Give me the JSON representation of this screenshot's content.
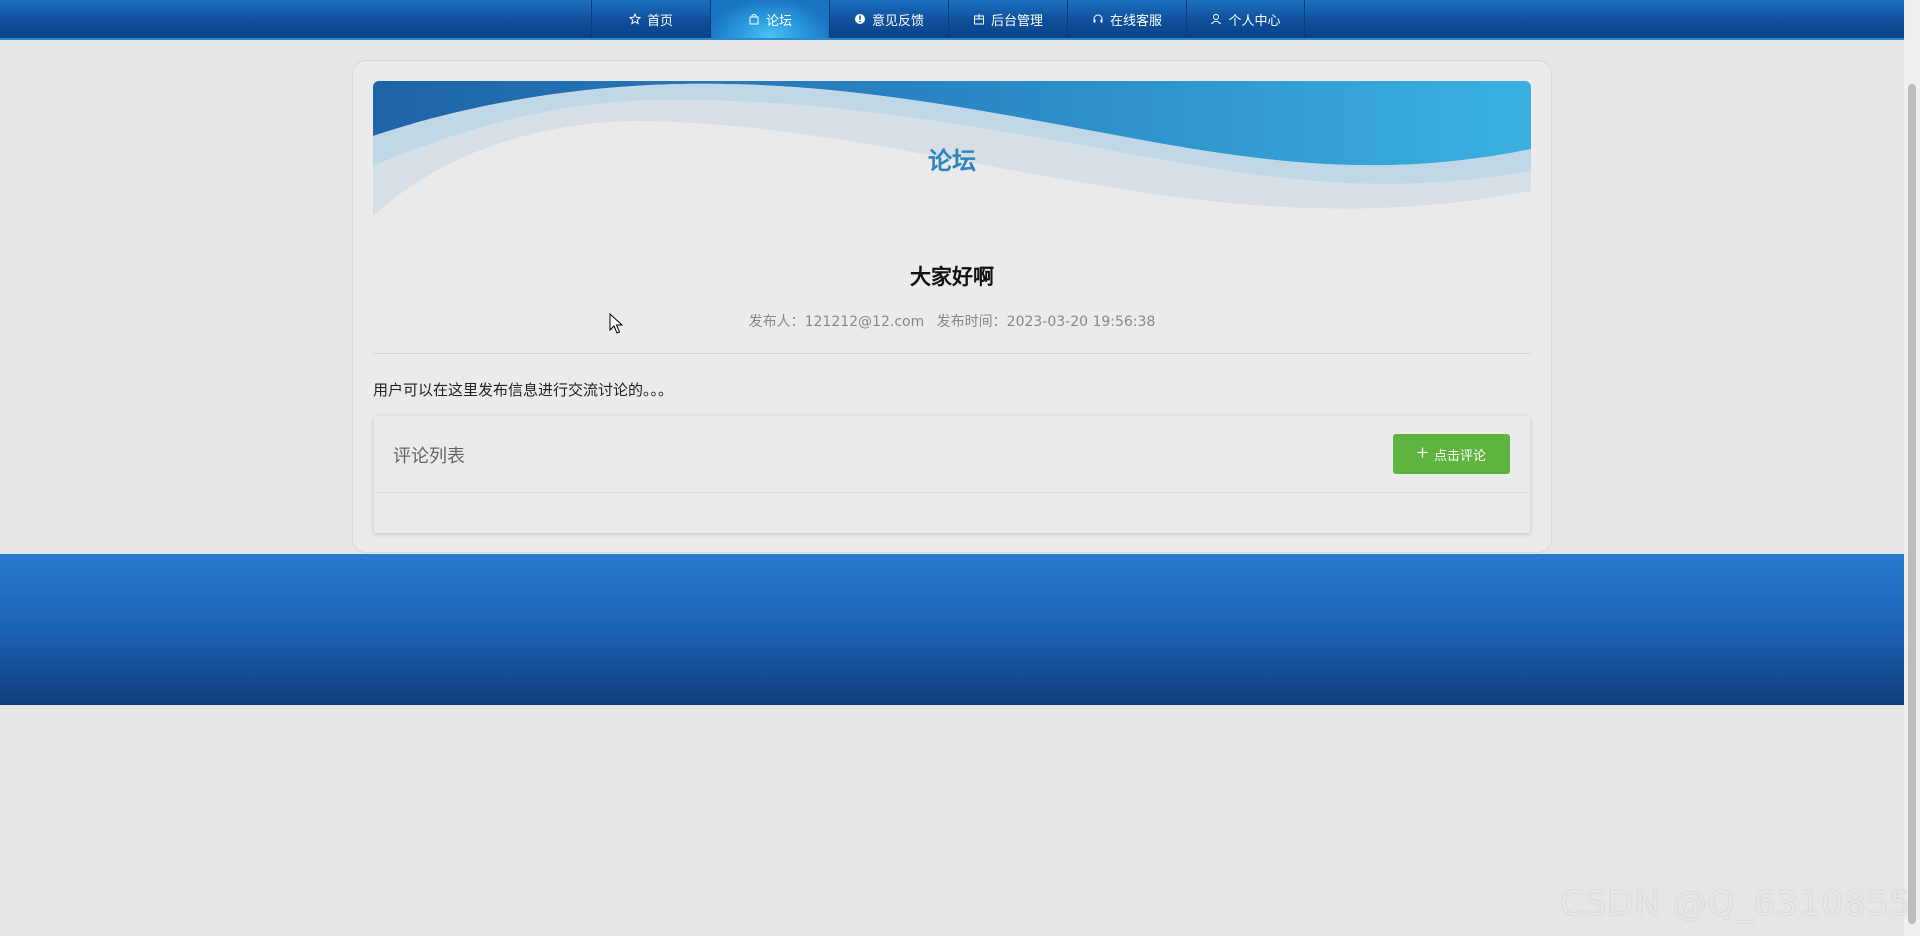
{
  "nav": {
    "items": [
      {
        "label": "首页",
        "icon": "star-icon"
      },
      {
        "label": "论坛",
        "icon": "bag-icon",
        "active": true
      },
      {
        "label": "意见反馈",
        "icon": "info-icon"
      },
      {
        "label": "后台管理",
        "icon": "cube-icon"
      },
      {
        "label": "在线客服",
        "icon": "headset-icon"
      },
      {
        "label": "个人中心",
        "icon": "user-icon"
      }
    ]
  },
  "banner": {
    "title": "论坛"
  },
  "post": {
    "title": "大家好啊",
    "author_label": "发布人：121212@12.com",
    "time_label": "发布时间：2023-03-20 19:56:38",
    "content": "用户可以在这里发布信息进行交流讨论的。。。"
  },
  "comments": {
    "title": "评论列表",
    "button_label": "点击评论"
  },
  "watermark": "CSDN @Q_6310855",
  "colors": {
    "nav_bg": "#0e4f9a",
    "accent": "#2b86bf",
    "button": "#5fb43f",
    "footer": "#1b62b6"
  }
}
